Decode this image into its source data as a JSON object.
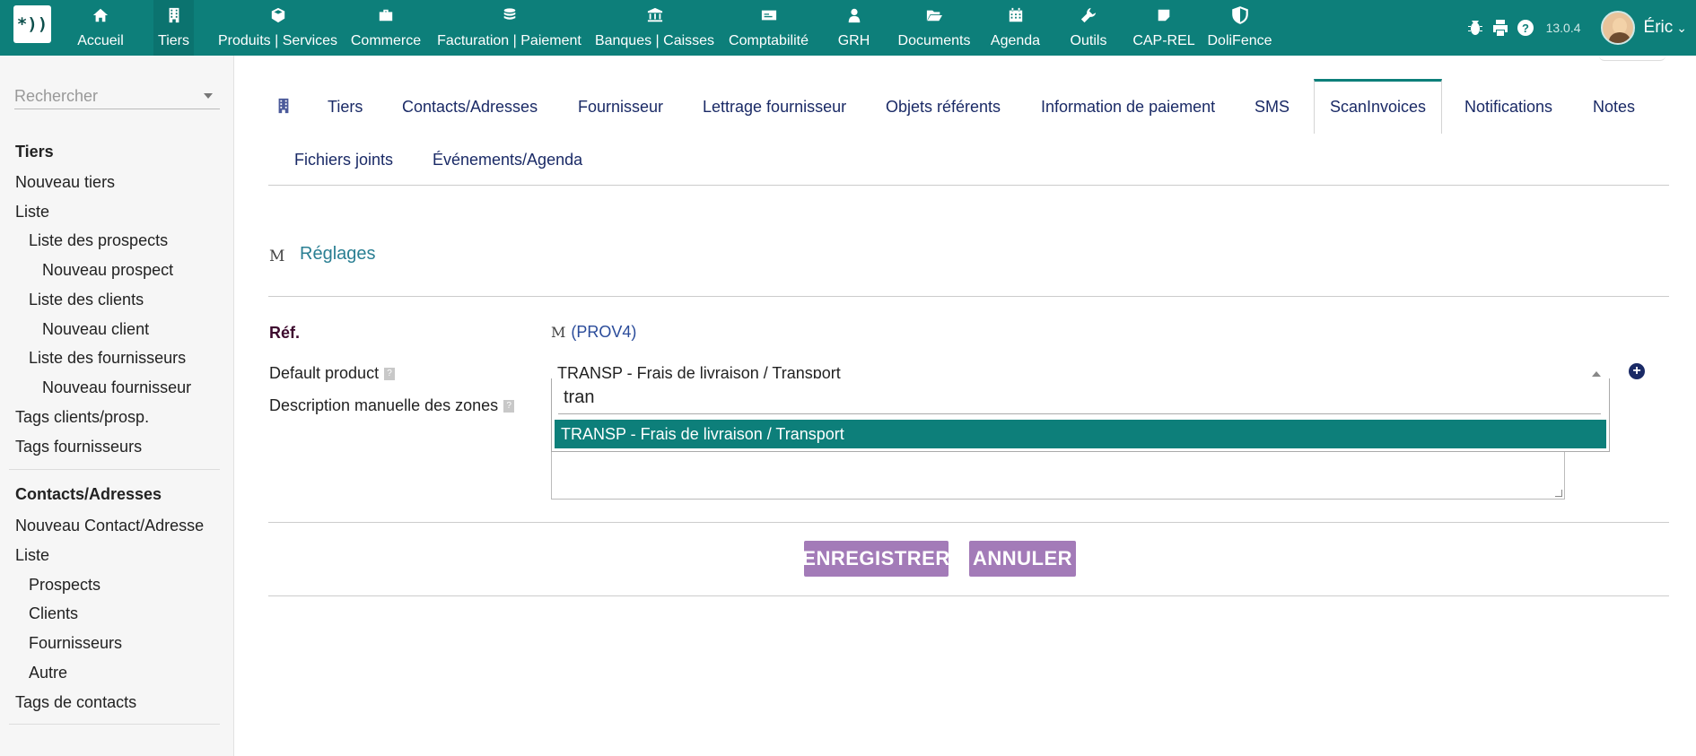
{
  "topbar": {
    "menu": [
      {
        "label": "Accueil",
        "icon": "home-icon"
      },
      {
        "label": "Tiers",
        "icon": "building-icon"
      },
      {
        "label": "Produits | Services",
        "icon": "cube-icon"
      },
      {
        "label": "Commerce",
        "icon": "suitcase-icon"
      },
      {
        "label": "Facturation | Paiement",
        "icon": "coins-icon"
      },
      {
        "label": "Banques | Caisses",
        "icon": "bank-icon"
      },
      {
        "label": "Comptabilité",
        "icon": "money-bill-icon"
      },
      {
        "label": "GRH",
        "icon": "user-tie-icon"
      },
      {
        "label": "Documents",
        "icon": "folder-open-icon"
      },
      {
        "label": "Agenda",
        "icon": "calendar-icon"
      },
      {
        "label": "Outils",
        "icon": "wrench-icon"
      },
      {
        "label": "CAP-REL",
        "icon": "note-icon"
      },
      {
        "label": "DoliFence",
        "icon": "shield-icon"
      }
    ],
    "version": "13.0.4",
    "username": "Éric",
    "accent": "#0d7f7a"
  },
  "sidebar": {
    "search_placeholder": "Rechercher",
    "items": [
      {
        "label": "Tiers",
        "kind": "title"
      },
      {
        "label": "Nouveau tiers"
      },
      {
        "label": "Liste"
      },
      {
        "label": "Liste des prospects"
      },
      {
        "label": "Nouveau prospect"
      },
      {
        "label": "Liste des clients"
      },
      {
        "label": "Nouveau client"
      },
      {
        "label": "Liste des fournisseurs"
      },
      {
        "label": "Nouveau fournisseur"
      },
      {
        "label": "Tags clients/prosp."
      },
      {
        "label": "Tags fournisseurs"
      },
      {
        "label": "Contacts/Adresses",
        "kind": "title"
      },
      {
        "label": "Nouveau Contact/Adresse"
      },
      {
        "label": "Liste"
      },
      {
        "label": "Prospects"
      },
      {
        "label": "Clients"
      },
      {
        "label": "Fournisseurs"
      },
      {
        "label": "Autre"
      },
      {
        "label": "Tags de contacts"
      }
    ]
  },
  "tabs": [
    {
      "label": "Tiers"
    },
    {
      "label": "Contacts/Adresses"
    },
    {
      "label": "Fournisseur"
    },
    {
      "label": "Lettrage fournisseur"
    },
    {
      "label": "Objets référents"
    },
    {
      "label": "Information de paiement"
    },
    {
      "label": "SMS"
    },
    {
      "label": "ScanInvoices",
      "active": true
    },
    {
      "label": "Notifications"
    },
    {
      "label": "Notes"
    },
    {
      "label": "Fichiers joints"
    },
    {
      "label": "Événements/Agenda"
    }
  ],
  "section": {
    "title": "Réglages"
  },
  "form": {
    "ref_label": "Réf.",
    "ref_value": "(PROV4)",
    "default_product_label": "Default product",
    "default_product_value": "TRANSP - Frais de livraison / Transport",
    "description_label": "Description manuelle des zones",
    "dropdown": {
      "search_value": "tran",
      "options": [
        "TRANSP - Frais de livraison / Transport"
      ]
    }
  },
  "buttons": {
    "save": "ENREGISTRER",
    "cancel": "ANNULER"
  }
}
